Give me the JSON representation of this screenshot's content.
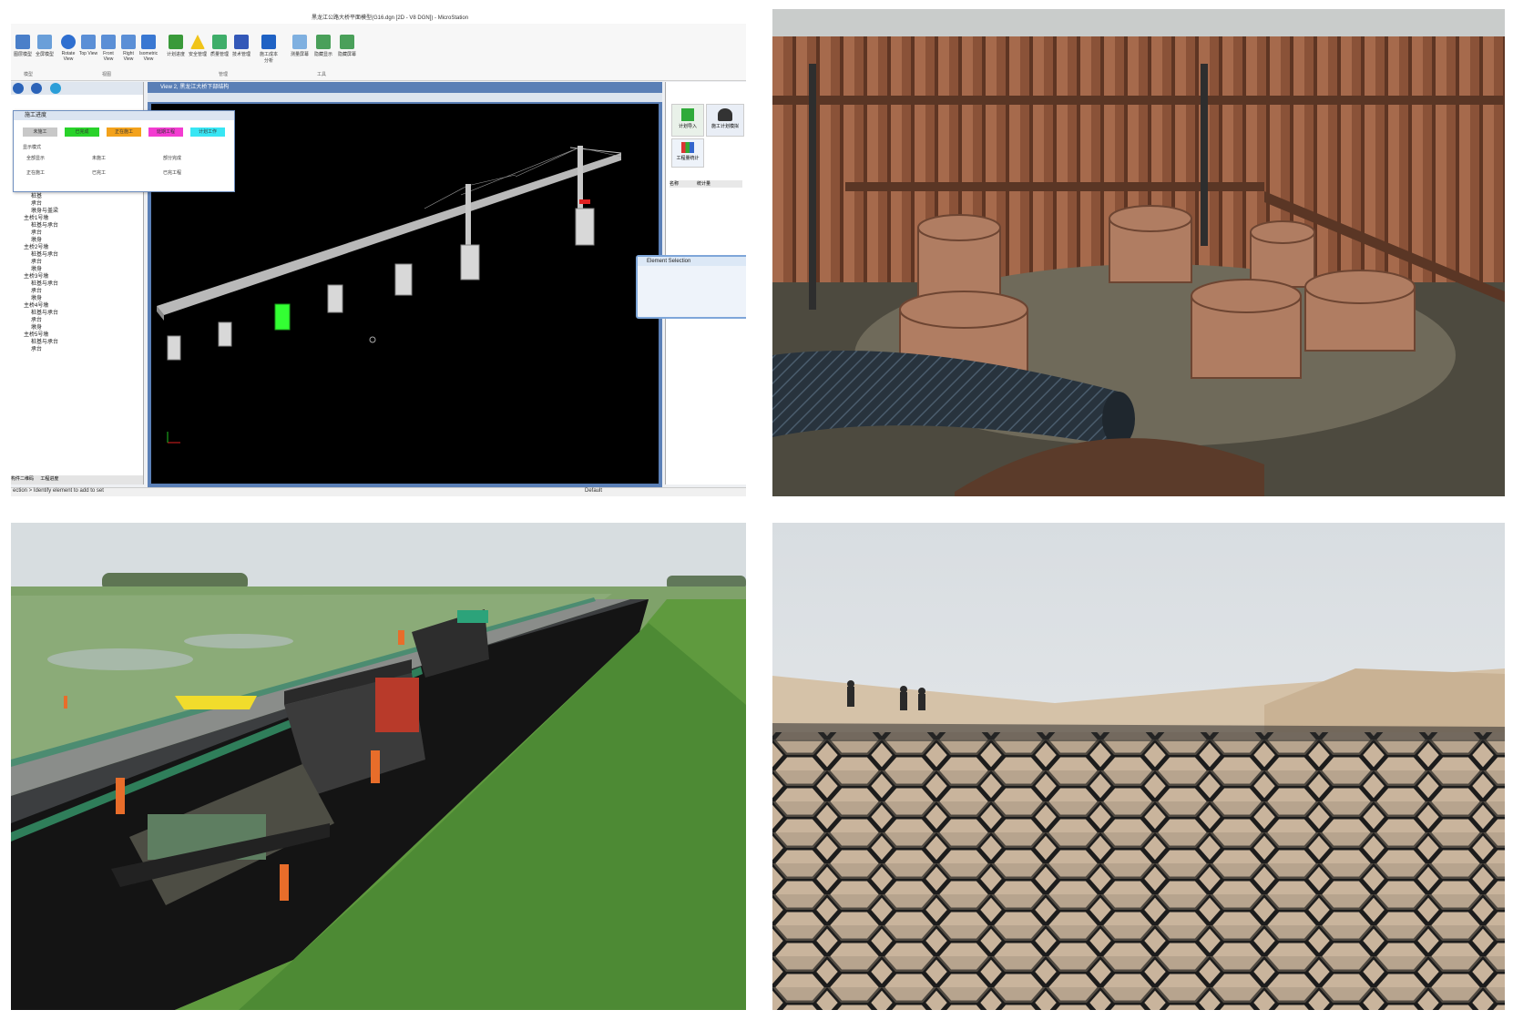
{
  "microstation": {
    "title": "黑龙江公路大桥平面模型(G16.dgn [2D - V8 DGN]) - MicroStation",
    "ribbon_left": [
      "图层模型",
      "全屏模型"
    ],
    "ribbon_views": [
      "Rotate View",
      "Top View",
      "Front View",
      "Right View",
      "Isometric View"
    ],
    "ribbon_mgmt": [
      "计划进度",
      "安全管理",
      "质量管理",
      "技术管理",
      "施工成本分析"
    ],
    "ribbon_tools": [
      "测量屏幕",
      "隐藏显示",
      "隐藏屏幕"
    ],
    "group_labels": [
      "模型",
      "视图",
      "管理",
      "工具"
    ],
    "view_title": "View 2, 黑龙江大桥下部结构",
    "dialog_title": "施工进度",
    "dialog_chips": [
      "未施工",
      "已完成",
      "正在施工",
      "延期工程",
      "计划工作"
    ],
    "dialog_section": "显示模式",
    "dialog_radios": [
      "全部显示",
      "未施工",
      "部分完成",
      "正在施工",
      "已完工",
      "已完工程"
    ],
    "tree_rows": [
      "桩基",
      "承台",
      "墩身与盖梁",
      "主桥1号墩",
      "桩基与承台",
      "承台",
      "墩身",
      "主桥2号墩",
      "桩基与承台",
      "承台",
      "墩身",
      "主桥3号墩",
      "桩基与承台",
      "承台",
      "墩身",
      "主桥4号墩",
      "桩基与承台",
      "承台",
      "墩身",
      "主桥5号墩",
      "桩基与承台",
      "承台"
    ],
    "right_panel_buttons": [
      "计划导入",
      "施工计划模拟",
      "工程量统计"
    ],
    "right_table_header": [
      "名称",
      "统计量"
    ],
    "element_selection_title": "Element Selection",
    "status_text": "ection > Identify element to add to set",
    "status_level": "Default",
    "bottom_tabs": [
      "构件二维码",
      "工程进度"
    ]
  },
  "photos": {
    "cofferdam": "steel sheet pile cofferdam",
    "paving": "asphalt paving",
    "geocell": "geocell"
  },
  "colors": {
    "chip_colors": [
      "#c8c8c8",
      "#29d22a",
      "#f3a21c",
      "#f33cd1",
      "#38e6f4"
    ],
    "selected_pier": "#33ff33",
    "canvas": "#000000"
  }
}
